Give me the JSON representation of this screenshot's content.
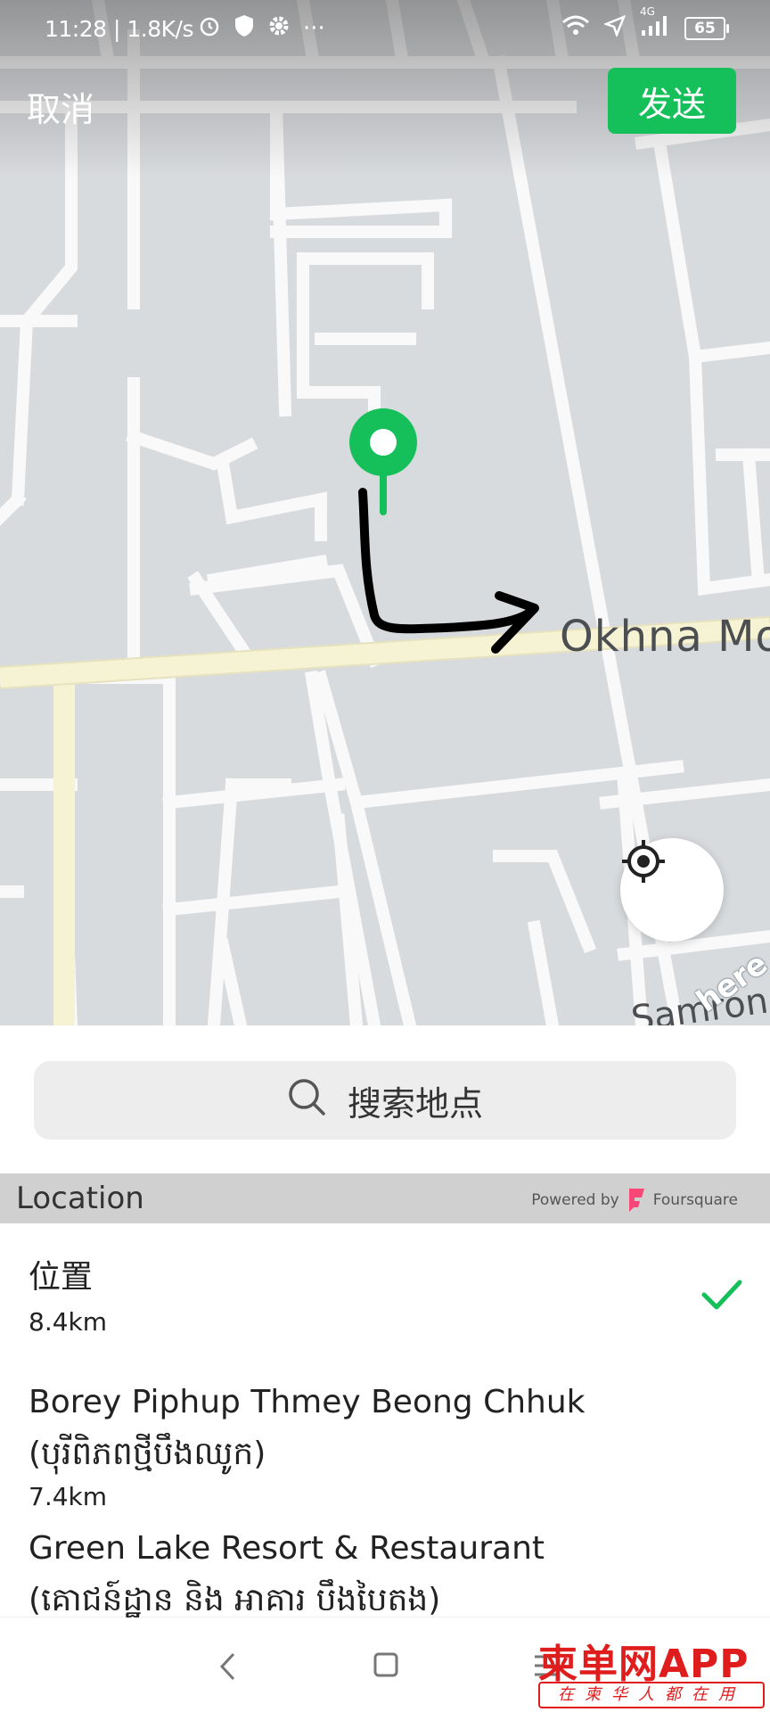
{
  "status_bar": {
    "time": "11:28 | 1.8K/s",
    "network_label": "4G",
    "battery": "65"
  },
  "top_bar": {
    "cancel_label": "取消",
    "send_label": "发送"
  },
  "map": {
    "street_label": "Okhna Mo",
    "street_label_2": "Samron",
    "provider_logo": "here",
    "pin_color": "#15c05b",
    "annotation_color": "#000000",
    "road_color": "#ffffff",
    "main_road_color": "#f6f3d4"
  },
  "search": {
    "placeholder": "搜索地点"
  },
  "section": {
    "title": "Location",
    "powered_by": "Powered by",
    "provider": "Foursquare"
  },
  "places": [
    {
      "name": "位置",
      "distance": "8.4km",
      "selected": true
    },
    {
      "name": "Borey Piphup Thmey Beong Chhuk",
      "name_line2": "(បុរីពិភពថ្មីបឹងឈូក)",
      "distance": "7.4km",
      "selected": false
    },
    {
      "name": "Green Lake Resort & Restaurant",
      "name_line2": "(គោជន៍ដ្ឋាន និង អាគារ បឹងបៃតង)",
      "distance": "",
      "selected": false
    }
  ],
  "watermark": {
    "main": "柬单网APP",
    "sub": "在柬华人都在用"
  },
  "colors": {
    "accent": "#15c05b",
    "watermark": "#e01d1d"
  }
}
